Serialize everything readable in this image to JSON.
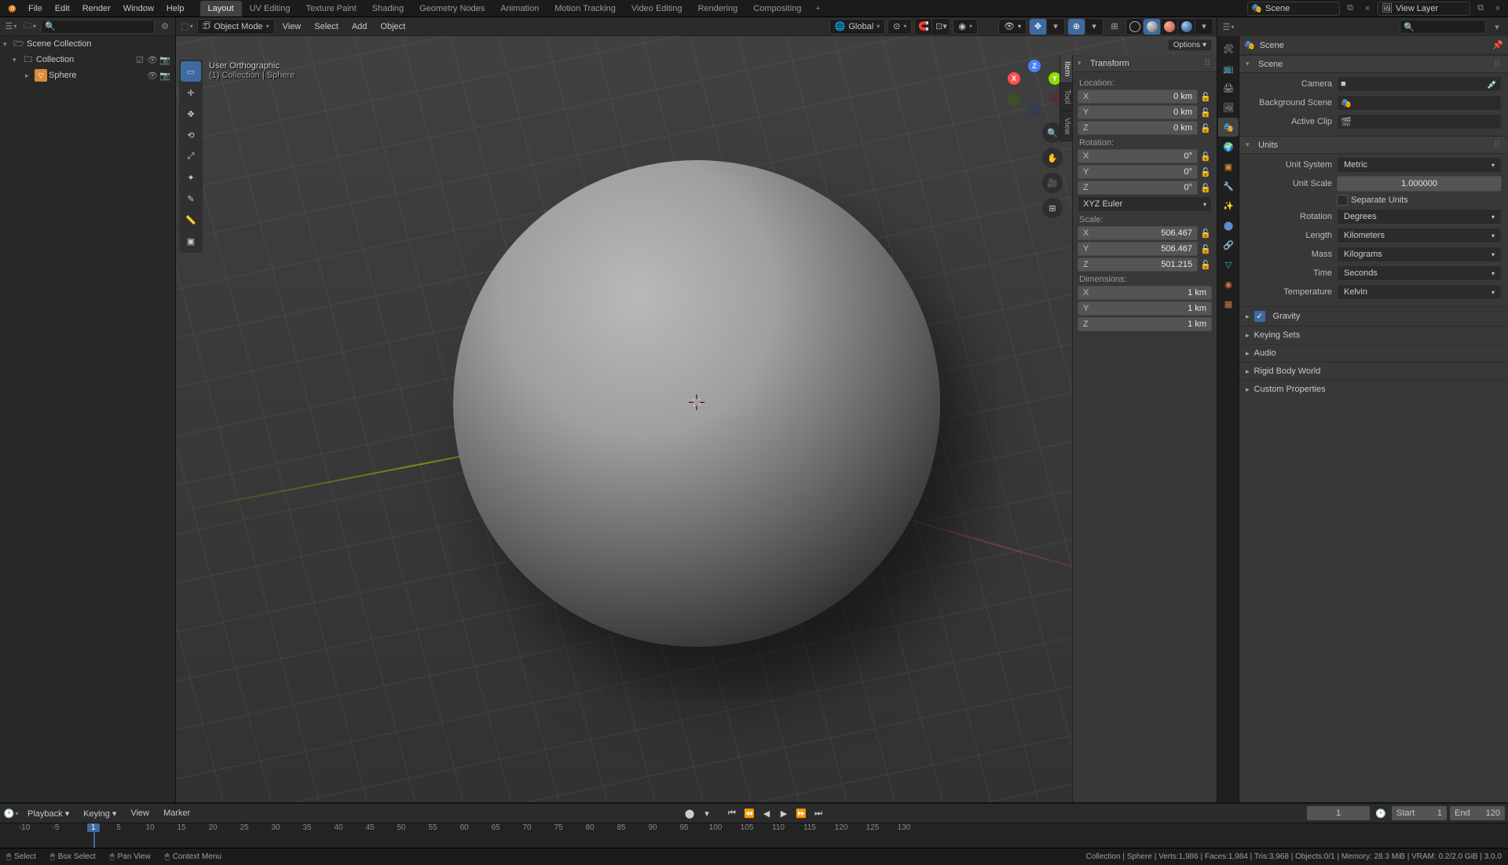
{
  "topbar": {
    "menus": [
      "File",
      "Edit",
      "Render",
      "Window",
      "Help"
    ],
    "workspaces": [
      "Layout",
      "UV Editing",
      "Texture Paint",
      "Shading",
      "Geometry Nodes",
      "Animation",
      "Motion Tracking",
      "Video Editing",
      "Rendering",
      "Compositing"
    ],
    "active_workspace": 0,
    "scene_label": "Scene",
    "viewlayer_label": "View Layer"
  },
  "outliner": {
    "root": "Scene Collection",
    "collection": "Collection",
    "object": "Sphere"
  },
  "viewport": {
    "mode": "Object Mode",
    "menus": [
      "View",
      "Select",
      "Add",
      "Object"
    ],
    "orientation": "Global",
    "overlay_line1": "User Orthographic",
    "overlay_line2": "(1) Collection | Sphere",
    "side_tabs": [
      "Item",
      "Tool",
      "View"
    ],
    "options_label": "Options"
  },
  "npanel": {
    "header": "Transform",
    "location_label": "Location:",
    "rotation_label": "Rotation:",
    "scale_label": "Scale:",
    "dimensions_label": "Dimensions:",
    "location": {
      "x": "0 km",
      "y": "0 km",
      "z": "0 km"
    },
    "rotation": {
      "x": "0°",
      "y": "0°",
      "z": "0°"
    },
    "rotation_mode": "XYZ Euler",
    "scale": {
      "x": "506.467",
      "y": "506.467",
      "z": "501.215"
    },
    "dimensions": {
      "x": "1 km",
      "y": "1 km",
      "z": "1 km"
    }
  },
  "properties": {
    "breadcrumb": "Scene",
    "scene": {
      "header": "Scene",
      "camera_label": "Camera",
      "bg_scene_label": "Background Scene",
      "active_clip_label": "Active Clip"
    },
    "units": {
      "header": "Units",
      "system_label": "Unit System",
      "system_value": "Metric",
      "scale_label": "Unit Scale",
      "scale_value": "1.000000",
      "separate_label": "Separate Units",
      "rotation_label": "Rotation",
      "rotation_value": "Degrees",
      "length_label": "Length",
      "length_value": "Kilometers",
      "mass_label": "Mass",
      "mass_value": "Kilograms",
      "time_label": "Time",
      "time_value": "Seconds",
      "temp_label": "Temperature",
      "temp_value": "Kelvin"
    },
    "collapsed": {
      "gravity": "Gravity",
      "keying": "Keying Sets",
      "audio": "Audio",
      "rigid": "Rigid Body World",
      "custom": "Custom Properties"
    }
  },
  "timeline": {
    "menus": [
      "Playback",
      "Keying",
      "View",
      "Marker"
    ],
    "current_frame": "1",
    "start_label": "Start",
    "start_value": "1",
    "end_label": "End",
    "end_value": "120",
    "ruler": [
      -10,
      -5,
      1,
      5,
      10,
      15,
      20,
      25,
      30,
      35,
      40,
      45,
      50,
      55,
      60,
      65,
      70,
      75,
      80,
      85,
      90,
      95,
      100,
      105,
      110,
      115,
      120,
      125,
      130
    ]
  },
  "statusbar": {
    "select": "Select",
    "box_select": "Box Select",
    "pan_view": "Pan View",
    "context_menu": "Context Menu",
    "right": "Collection | Sphere | Verts:1,986 | Faces:1,984 | Tris:3,968 | Objects:0/1 | Memory: 28.3 MiB | VRAM: 0.2/2.0 GiB | 3.0.0"
  }
}
